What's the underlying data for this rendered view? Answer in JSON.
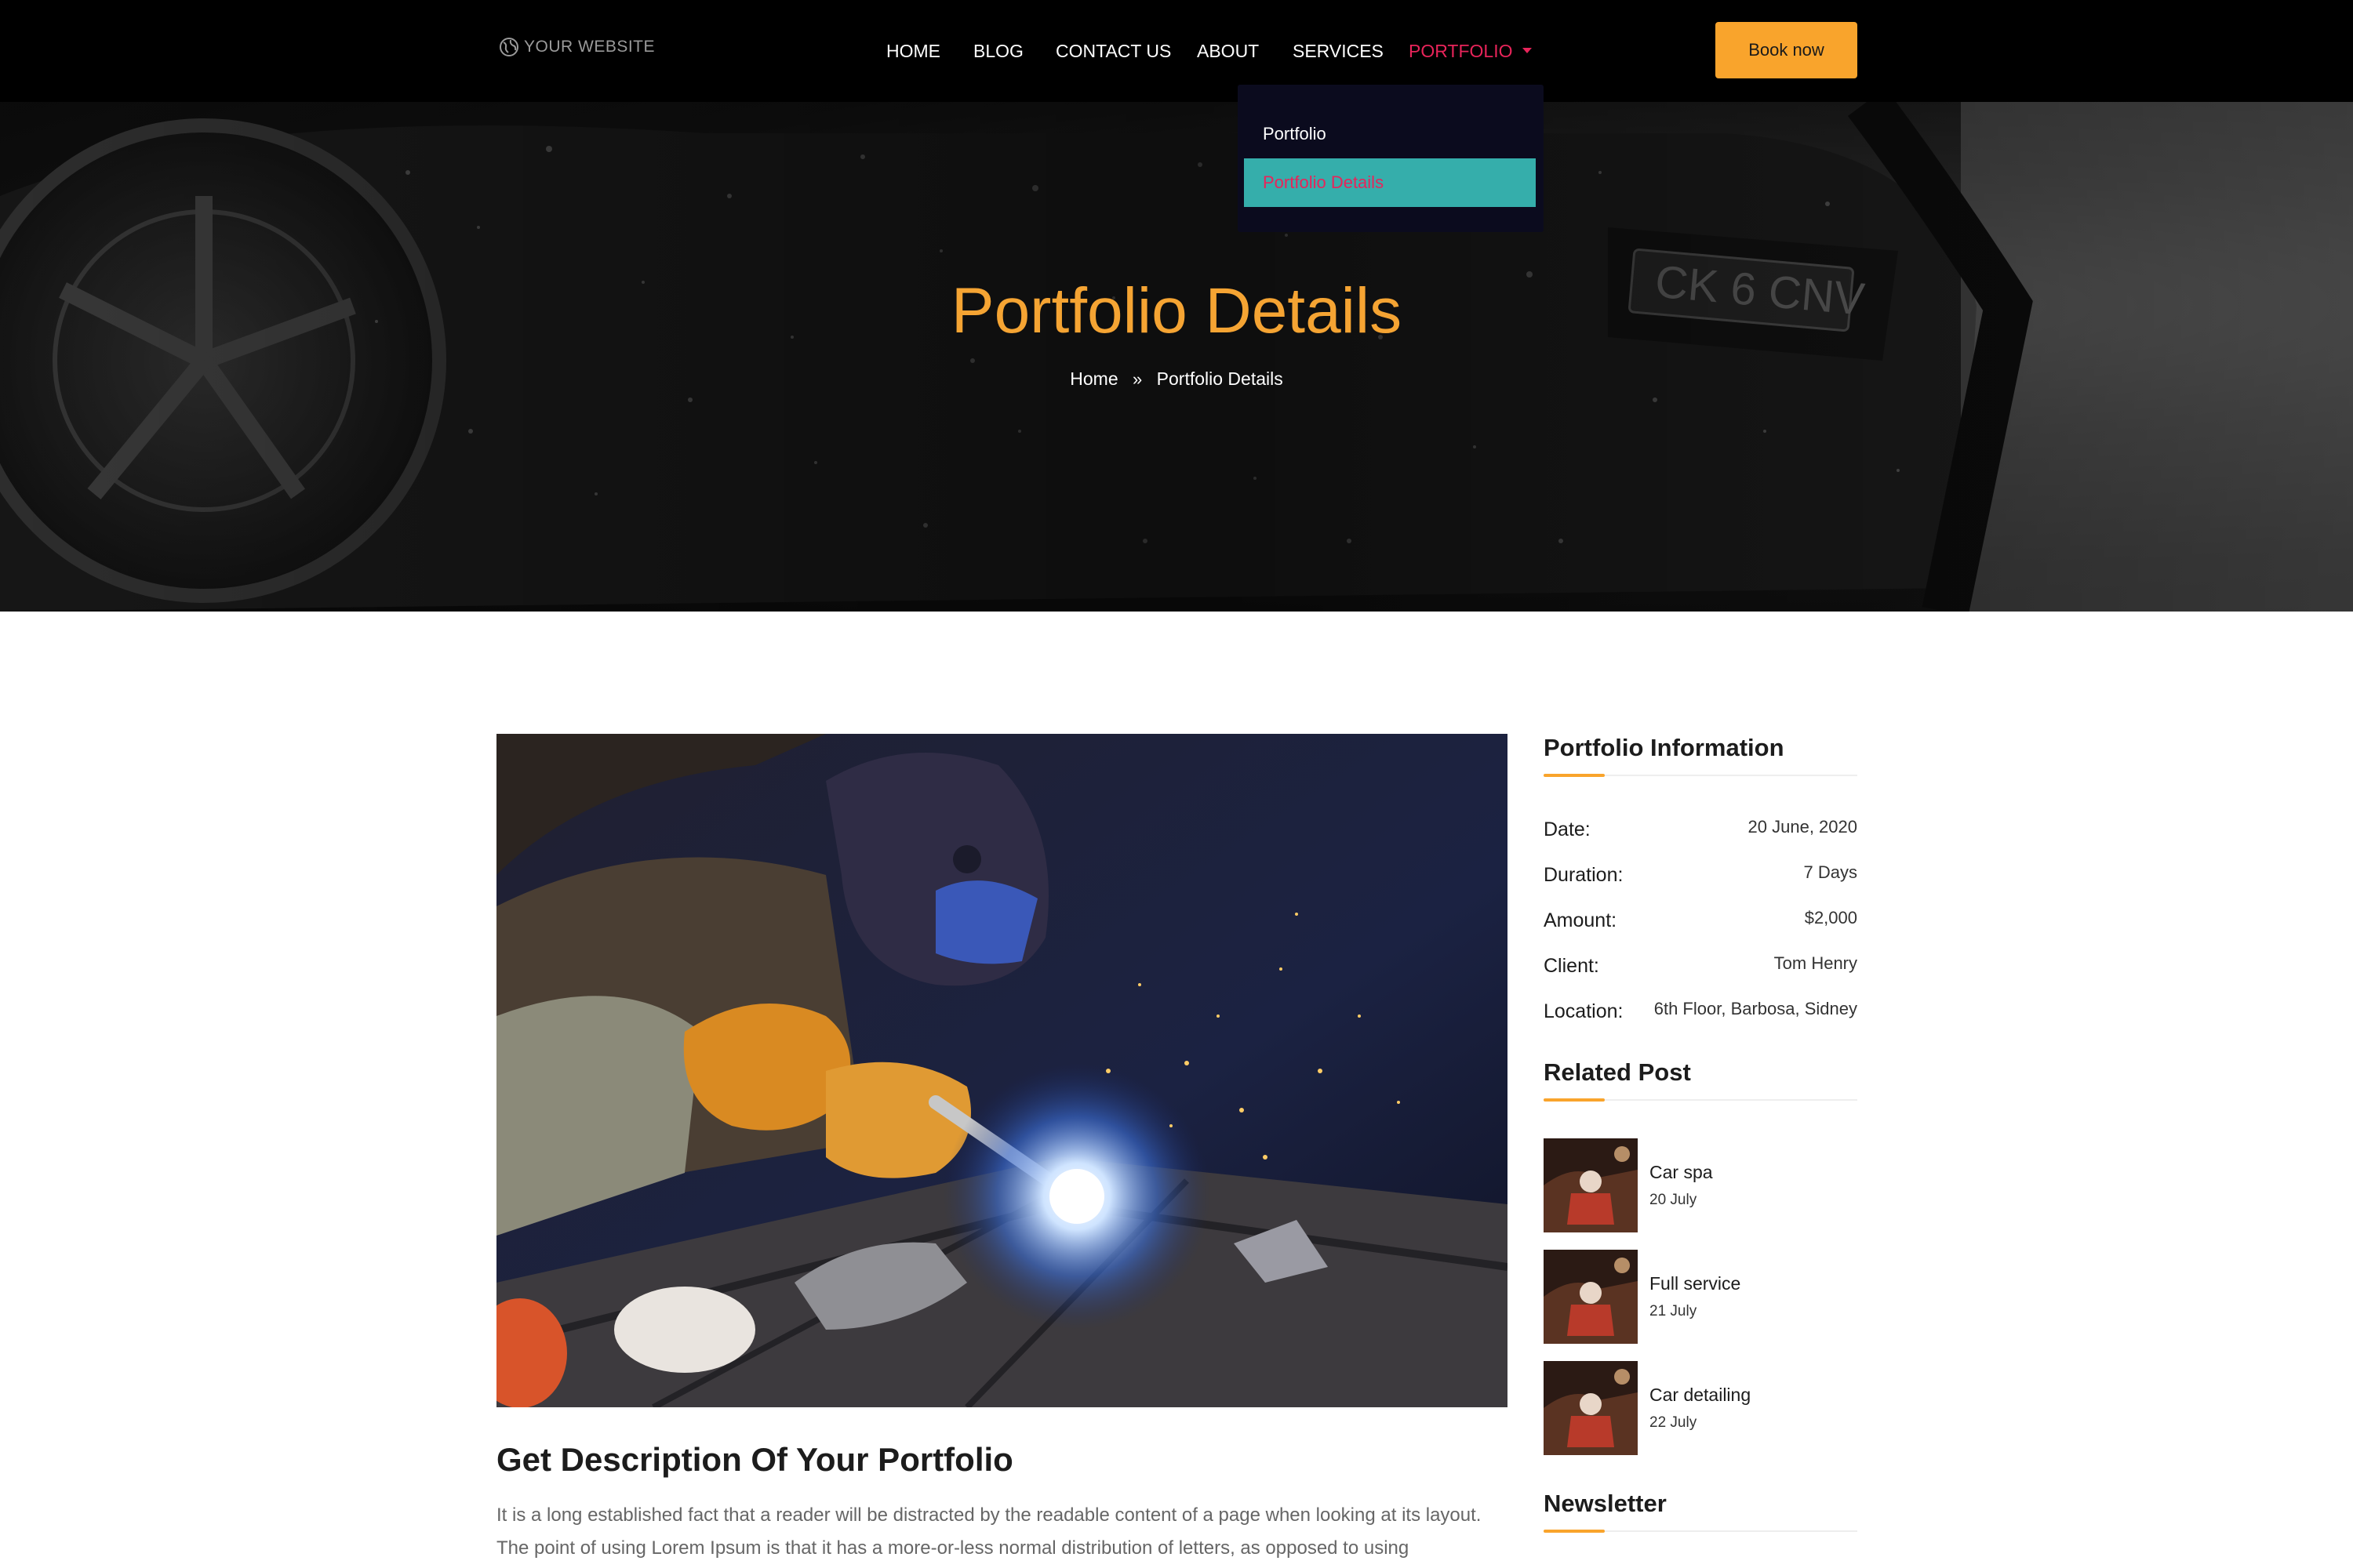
{
  "brand": {
    "logo_text": "YOUR WEBSITE",
    "logo_icon": "globe-icon"
  },
  "nav": {
    "items": [
      {
        "label": "HOME"
      },
      {
        "label": "BLOG"
      },
      {
        "label": "CONTACT US"
      },
      {
        "label": "ABOUT"
      },
      {
        "label": "SERVICES"
      },
      {
        "label": "PORTFOLIO",
        "active": true
      }
    ],
    "cta_label": "Book now"
  },
  "dropdown": {
    "items": [
      {
        "label": "Portfolio"
      },
      {
        "label": "Portfolio Details",
        "highlighted": true
      }
    ]
  },
  "hero": {
    "title": "Portfolio Details",
    "breadcrumb": {
      "home": "Home",
      "separator": "»",
      "current": "Portfolio Details"
    }
  },
  "main": {
    "image_alt": "welder-photo",
    "heading": "Get Description Of Your Portfolio",
    "paragraph": "It is a long established fact that a reader will be distracted by the readable content of a page when looking at its layout. The point of using Lorem Ipsum is that it has a more-or-less normal distribution of letters, as opposed to using"
  },
  "sidebar": {
    "info_title": "Portfolio Information",
    "info": [
      {
        "label": "Date:",
        "value": "20 June, 2020"
      },
      {
        "label": "Duration:",
        "value": "7 Days"
      },
      {
        "label": "Amount:",
        "value": "$2,000"
      },
      {
        "label": "Client:",
        "value": "Tom Henry"
      },
      {
        "label": "Location:",
        "value": "6th Floor, Barbosa, Sidney"
      }
    ],
    "related_title": "Related Post",
    "related": [
      {
        "title": "Car spa",
        "date": "20 July"
      },
      {
        "title": "Full service",
        "date": "21 July"
      },
      {
        "title": "Car detailing",
        "date": "22 July"
      }
    ],
    "newsletter_title": "Newsletter"
  },
  "colors": {
    "accent_orange": "#f9a42c",
    "active_pink": "#e8245a",
    "dropdown_teal": "#35aeab",
    "navbar_bg": "#000000"
  }
}
